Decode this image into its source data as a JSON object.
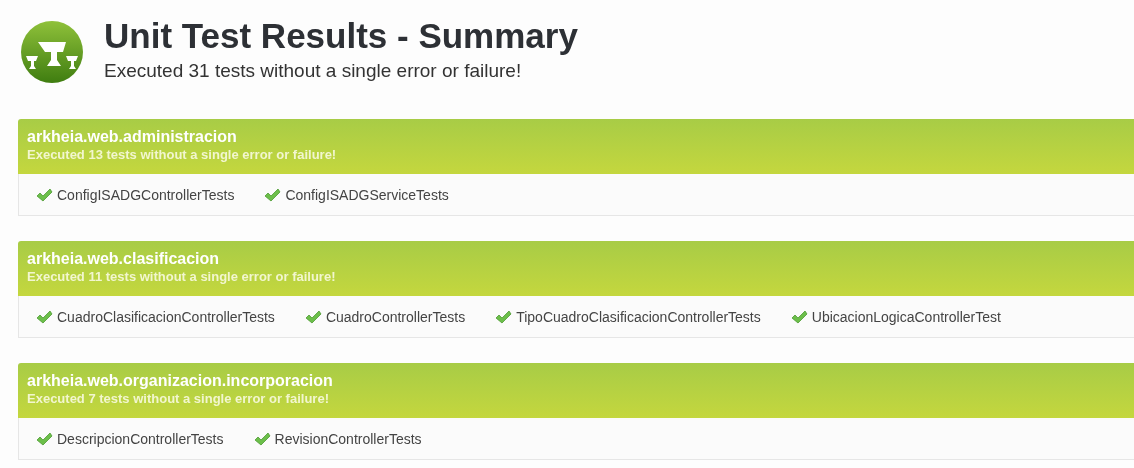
{
  "header": {
    "title": "Unit Test Results - Summary",
    "subtitle": "Executed 31 tests without a single error or failure!"
  },
  "sections": [
    {
      "name": "arkheia.web.administracion",
      "summary": "Executed 13 tests without a single error or failure!",
      "tests": [
        "ConfigISADGControllerTests",
        "ConfigISADGServiceTests"
      ]
    },
    {
      "name": "arkheia.web.clasificacion",
      "summary": "Executed 11 tests without a single error or failure!",
      "tests": [
        "CuadroClasificacionControllerTests",
        "CuadroControllerTests",
        "TipoCuadroClasificacionControllerTests",
        "UbicacionLogicaControllerTest"
      ]
    },
    {
      "name": "arkheia.web.organizacion.incorporacion",
      "summary": "Executed 7 tests without a single error or failure!",
      "tests": [
        "DescripcionControllerTests",
        "RevisionControllerTests"
      ]
    }
  ]
}
